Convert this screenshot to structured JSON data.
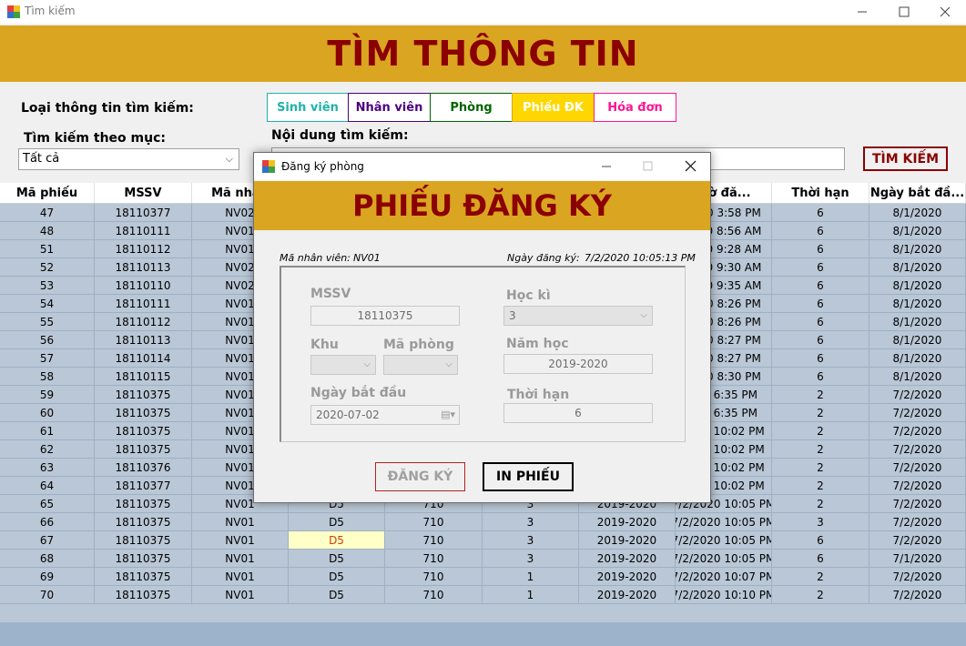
{
  "window": {
    "title": "Tìm kiếm",
    "banner": "TÌM THÔNG TIN"
  },
  "search": {
    "type_label": "Loại thông tin tìm kiếm:",
    "type_buttons": [
      {
        "label": "Sinh viên",
        "color": "#20b2aa"
      },
      {
        "label": "Nhân viên",
        "color": "#4b0082"
      },
      {
        "label": "Phòng",
        "color": "#006400"
      },
      {
        "label": "Phiếu ĐK",
        "color": "#ffffff"
      },
      {
        "label": "Hóa đơn",
        "color": "#ff1493"
      }
    ],
    "filter_label": "Tìm kiếm theo mục:",
    "filter_value": "Tất cả",
    "content_label": "Nội dung tìm kiếm:",
    "content_value": "",
    "button_label": "TÌM KIẾM"
  },
  "grid": {
    "columns": [
      "Mã phiếu",
      "MSSV",
      "Mã nhân",
      "",
      "",
      "",
      "",
      "giờ đă...",
      "Thời hạn",
      "Ngày bắt đầ..."
    ],
    "rows": [
      [
        "47",
        "18110377",
        "NV02",
        "",
        "",
        "",
        "",
        "2020 3:58 PM",
        "6",
        "8/1/2020"
      ],
      [
        "48",
        "18110111",
        "NV01",
        "",
        "",
        "",
        "",
        "2020 8:56 AM",
        "6",
        "8/1/2020"
      ],
      [
        "51",
        "18110112",
        "NV01",
        "",
        "",
        "",
        "",
        "2020 9:28 AM",
        "6",
        "8/1/2020"
      ],
      [
        "52",
        "18110113",
        "NV02",
        "",
        "",
        "",
        "",
        "2020 9:30 AM",
        "6",
        "8/1/2020"
      ],
      [
        "53",
        "18110110",
        "NV02",
        "",
        "",
        "",
        "",
        "2020 9:35 AM",
        "6",
        "8/1/2020"
      ],
      [
        "54",
        "18110111",
        "NV01",
        "",
        "",
        "",
        "",
        "2020 8:26 PM",
        "6",
        "8/1/2020"
      ],
      [
        "55",
        "18110112",
        "NV01",
        "",
        "",
        "",
        "",
        "2020 8:26 PM",
        "6",
        "8/1/2020"
      ],
      [
        "56",
        "18110113",
        "NV01",
        "",
        "",
        "",
        "",
        "2020 8:27 PM",
        "6",
        "8/1/2020"
      ],
      [
        "57",
        "18110114",
        "NV01",
        "",
        "",
        "",
        "",
        "2020 8:27 PM",
        "6",
        "8/1/2020"
      ],
      [
        "58",
        "18110115",
        "NV01",
        "",
        "",
        "",
        "",
        "2020 8:30 PM",
        "6",
        "8/1/2020"
      ],
      [
        "59",
        "18110375",
        "NV01",
        "",
        "",
        "",
        "",
        "020 6:35 PM",
        "2",
        "7/2/2020"
      ],
      [
        "60",
        "18110375",
        "NV01",
        "",
        "",
        "",
        "",
        "020 6:35 PM",
        "2",
        "7/2/2020"
      ],
      [
        "61",
        "18110375",
        "NV01",
        "",
        "",
        "",
        "",
        "2020 10:02 PM",
        "2",
        "7/2/2020"
      ],
      [
        "62",
        "18110375",
        "NV01",
        "",
        "",
        "",
        "",
        "2020 10:02 PM",
        "2",
        "7/2/2020"
      ],
      [
        "63",
        "18110376",
        "NV01",
        "",
        "",
        "",
        "",
        "2020 10:02 PM",
        "2",
        "7/2/2020"
      ],
      [
        "64",
        "18110377",
        "NV01",
        "",
        "",
        "",
        "",
        "2020 10:02 PM",
        "2",
        "7/2/2020"
      ],
      [
        "65",
        "18110375",
        "NV01",
        "D5",
        "710",
        "3",
        "2019-2020",
        "7/2/2020 10:05 PM",
        "2",
        "7/2/2020"
      ],
      [
        "66",
        "18110375",
        "NV01",
        "D5",
        "710",
        "3",
        "2019-2020",
        "7/2/2020 10:05 PM",
        "3",
        "7/2/2020"
      ],
      [
        "67",
        "18110375",
        "NV01",
        "D5",
        "710",
        "3",
        "2019-2020",
        "7/2/2020 10:05 PM",
        "6",
        "7/2/2020"
      ],
      [
        "68",
        "18110375",
        "NV01",
        "D5",
        "710",
        "3",
        "2019-2020",
        "7/2/2020 10:05 PM",
        "6",
        "7/1/2020"
      ],
      [
        "69",
        "18110375",
        "NV01",
        "D5",
        "710",
        "1",
        "2019-2020",
        "7/2/2020 10:07 PM",
        "2",
        "7/2/2020"
      ],
      [
        "70",
        "18110375",
        "NV01",
        "D5",
        "710",
        "1",
        "2019-2020",
        "7/2/2020 10:10 PM",
        "2",
        "7/2/2020"
      ]
    ]
  },
  "dialog": {
    "title": "Đăng ký phòng",
    "banner": "PHIẾU ĐĂNG KÝ",
    "staff_label": "Mã nhân viên:",
    "staff_value": "NV01",
    "date_label": "Ngày đăng ký:",
    "date_value": "7/2/2020 10:05:13 PM",
    "mssv_label": "MSSV",
    "mssv_value": "18110375",
    "semester_label": "Học kì",
    "semester_value": "3",
    "khu_label": "Khu",
    "room_label": "Mã phòng",
    "year_label": "Năm học",
    "year_value": "2019-2020",
    "start_label": "Ngày bắt đầu",
    "start_value": "2020-07-02",
    "term_label": "Thời hạn",
    "term_value": "6",
    "register_button": "ĐĂNG KÝ",
    "print_button": "IN PHIẾU"
  }
}
